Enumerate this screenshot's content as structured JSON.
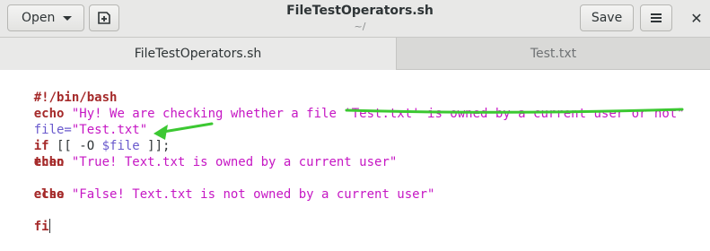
{
  "header": {
    "open_label": "Open",
    "title": "FileTestOperators.sh",
    "subtitle": "~/",
    "save_label": "Save"
  },
  "tabs": [
    {
      "label": "FileTestOperators.sh",
      "active": true
    },
    {
      "label": "Test.txt",
      "active": false
    }
  ],
  "code": {
    "shebang": "#!/bin/bash",
    "echo_kw": "echo",
    "echo_str": "\"Hy! We are checking whether a file 'Test.txt' is owned by a current user or not\"",
    "assign_var": "file=",
    "assign_str": "\"Test.txt\"",
    "if_kw": "if",
    "test_open": " [[ -O ",
    "test_var": "$file",
    "test_close": " ]];",
    "then_kw": "then",
    "echo2_kw": "echo",
    "echo2_str": "\"True! Text.txt is owned by a current user\"",
    "else_kw": "else",
    "echo3_kw": "echo",
    "echo3_str": "\"False! Text.txt is not owned by a current user\"",
    "fi_kw": "fi"
  },
  "colors": {
    "keyword": "#a52a2a",
    "string": "#c617c4",
    "variable": "#6a5acd",
    "annotation": "#3cc832"
  },
  "icons": [
    "caret-down-icon",
    "new-document-icon",
    "hamburger-menu-icon",
    "close-icon",
    "arrow-annotation",
    "underline-annotation"
  ]
}
